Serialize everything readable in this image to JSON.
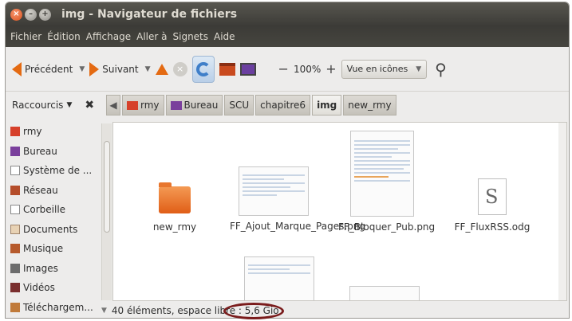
{
  "window": {
    "title": "img - Navigateur de fichiers"
  },
  "menu": [
    "Fichier",
    "Édition",
    "Affichage",
    "Aller à",
    "Signets",
    "Aide"
  ],
  "toolbar": {
    "back_label": "Précédent",
    "forward_label": "Suivant",
    "zoom_level": "100%",
    "view_mode": "Vue en icônes"
  },
  "places": {
    "header": "Raccourcis",
    "items": [
      {
        "label": "rmy",
        "icon": "home-folder-icon",
        "color": "#d6402a"
      },
      {
        "label": "Bureau",
        "icon": "desktop-icon",
        "color": "#7a3f9c"
      },
      {
        "label": "Système de ...",
        "icon": "filesystem-icon",
        "color": "#8a8a8a"
      },
      {
        "label": "Réseau",
        "icon": "network-icon",
        "color": "#b54d2a"
      },
      {
        "label": "Corbeille",
        "icon": "trash-icon",
        "color": "#8a8a8a"
      },
      {
        "label": "Documents",
        "icon": "documents-folder-icon",
        "color": "#d0a070"
      },
      {
        "label": "Musique",
        "icon": "music-folder-icon",
        "color": "#b65a2c"
      },
      {
        "label": "Images",
        "icon": "images-folder-icon",
        "color": "#6c6c6c"
      },
      {
        "label": "Vidéos",
        "icon": "videos-folder-icon",
        "color": "#7a2e2e"
      },
      {
        "label": "Téléchargem...",
        "icon": "downloads-folder-icon",
        "color": "#c07a3a"
      }
    ]
  },
  "breadcrumb": [
    "rmy",
    "Bureau",
    "SCU",
    "chapitre6",
    "img",
    "new_rmy"
  ],
  "files": [
    {
      "name": "new_rmy",
      "type": "folder"
    },
    {
      "name": "FF_Ajout_Marque_Pages.png",
      "type": "image"
    },
    {
      "name": "FF_Bloquer_Pub.png",
      "type": "image"
    },
    {
      "name": "FF_FluxRSS.odg",
      "type": "drawing"
    }
  ],
  "status": {
    "text": "40 éléments, espace libre : 5,6 Gio"
  },
  "colors": {
    "accent": "#e46a12",
    "annotation": "#7a1c1c"
  }
}
